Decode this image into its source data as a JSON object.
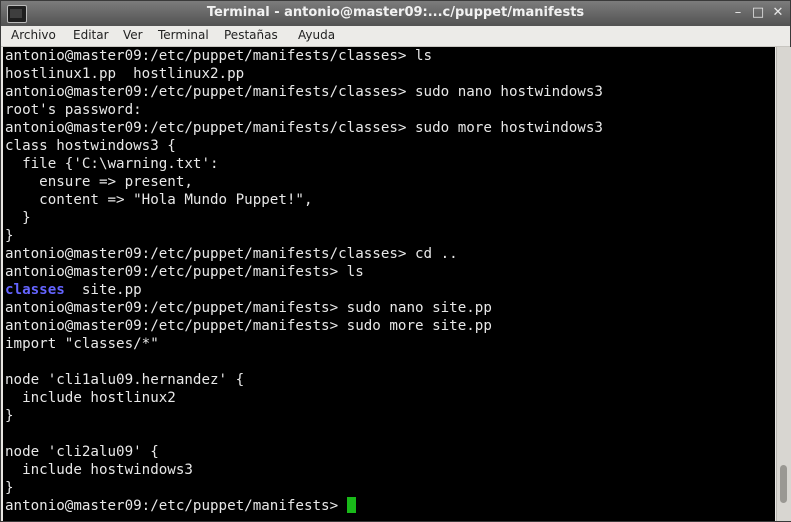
{
  "window": {
    "title": "Terminal - antonio@master09:...c/puppet/manifests"
  },
  "menu": [
    "Archivo",
    "Editar",
    "Ver",
    "Terminal",
    "Pestañas",
    "Ayuda"
  ],
  "lines": [
    "antonio@master09:/etc/puppet/manifests/classes> ls",
    "hostlinux1.pp  hostlinux2.pp",
    "antonio@master09:/etc/puppet/manifests/classes> sudo nano hostwindows3",
    "root's password:",
    "antonio@master09:/etc/puppet/manifests/classes> sudo more hostwindows3",
    "class hostwindows3 {",
    "  file {'C:\\warning.txt':",
    "    ensure => present,",
    "    content => \"Hola Mundo Puppet!\",",
    "  }",
    "}",
    "antonio@master09:/etc/puppet/manifests/classes> cd ..",
    "antonio@master09:/etc/puppet/manifests> ls",
    "",
    "antonio@master09:/etc/puppet/manifests> sudo nano site.pp",
    "antonio@master09:/etc/puppet/manifests> sudo more site.pp",
    "import \"classes/*\"",
    "",
    "node 'cli1alu09.hernandez' {",
    "  include hostlinux2",
    "}",
    "",
    "node 'cli2alu09' {",
    "  include hostwindows3",
    "}",
    "antonio@master09:/etc/puppet/manifests> "
  ],
  "ls_output": {
    "dir": "classes",
    "file": "  site.pp"
  }
}
